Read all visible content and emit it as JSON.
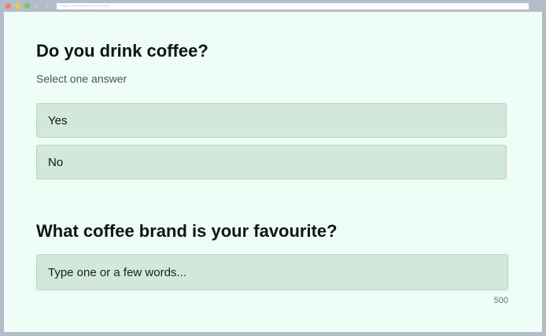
{
  "browser": {
    "address_text": "https://example.com/survey",
    "back_glyph": "‹",
    "forward_glyph": "›",
    "colors": {
      "chrome": "#b3bcc7",
      "close": "#f07c6b",
      "minimize": "#f3c94a",
      "maximize": "#74c965"
    }
  },
  "survey": {
    "q1": {
      "title": "Do you drink coffee?",
      "hint": "Select one answer",
      "options": [
        {
          "label": "Yes"
        },
        {
          "label": "No"
        }
      ]
    },
    "q2": {
      "title": "What coffee brand is your favourite?",
      "input_value": "",
      "input_placeholder": "Type one or a few words...",
      "char_limit": "500"
    }
  },
  "colors": {
    "background": "#eefdf6",
    "option_fill": "#d3e8dc",
    "option_border": "#b9d4c5",
    "text": "#0d1512"
  }
}
